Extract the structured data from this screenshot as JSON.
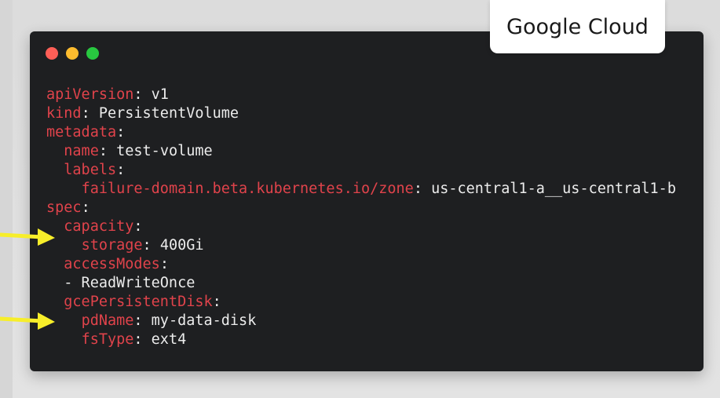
{
  "badge": {
    "label": "Google Cloud"
  },
  "window": {
    "controls": {
      "close_color": "#ff5f57",
      "minimize_color": "#febc2e",
      "maximize_color": "#28c840"
    }
  },
  "colors": {
    "key": "#e0434b",
    "value": "#ececec",
    "terminal_bg": "#1e1f21",
    "arrow": "#f7ee2a"
  },
  "code": {
    "lines": [
      {
        "indent": "",
        "key": "apiVersion",
        "sep": ": ",
        "value": "v1"
      },
      {
        "indent": "",
        "key": "kind",
        "sep": ": ",
        "value": "PersistentVolume"
      },
      {
        "indent": "",
        "key": "metadata",
        "sep": ":",
        "value": ""
      },
      {
        "indent": "  ",
        "key": "name",
        "sep": ": ",
        "value": "test-volume"
      },
      {
        "indent": "  ",
        "key": "labels",
        "sep": ":",
        "value": ""
      },
      {
        "indent": "    ",
        "key": "failure-domain.beta.kubernetes.io/zone",
        "sep": ": ",
        "value": "us-central1-a__us-central1-b"
      },
      {
        "indent": "",
        "key": "spec",
        "sep": ":",
        "value": ""
      },
      {
        "indent": "  ",
        "key": "capacity",
        "sep": ":",
        "value": ""
      },
      {
        "indent": "    ",
        "key": "storage",
        "sep": ": ",
        "value": "400Gi"
      },
      {
        "indent": "  ",
        "key": "accessModes",
        "sep": ":",
        "value": ""
      },
      {
        "indent": "  ",
        "key": "",
        "sep": "",
        "value": "- ReadWriteOnce"
      },
      {
        "indent": "  ",
        "key": "gcePersistentDisk",
        "sep": ":",
        "value": ""
      },
      {
        "indent": "    ",
        "key": "pdName",
        "sep": ": ",
        "value": "my-data-disk"
      },
      {
        "indent": "    ",
        "key": "fsType",
        "sep": ": ",
        "value": "ext4"
      }
    ]
  },
  "annotations": {
    "arrows": [
      {
        "name": "arrow-capacity",
        "target": "capacity"
      },
      {
        "name": "arrow-pdname",
        "target": "pdName"
      }
    ]
  }
}
